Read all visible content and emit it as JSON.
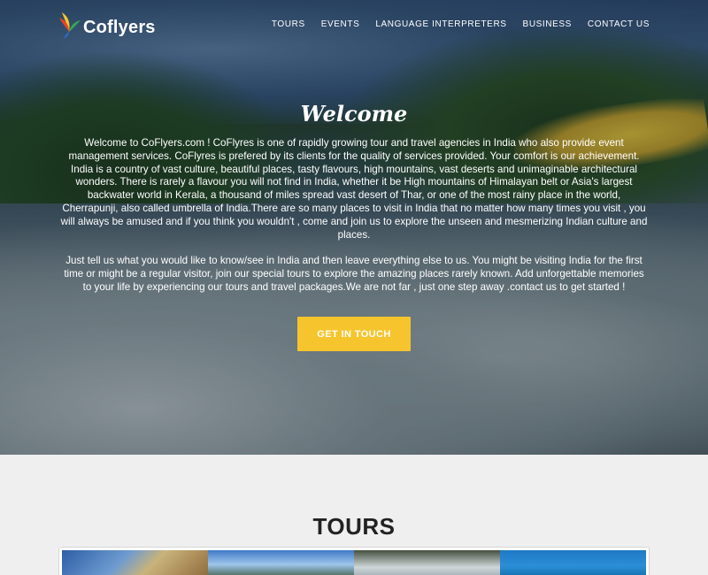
{
  "brand": {
    "name": "Coflyers"
  },
  "nav": {
    "items": [
      {
        "label": "TOURS"
      },
      {
        "label": "EVENTS"
      },
      {
        "label": "LANGUAGE INTERPRETERS"
      },
      {
        "label": "BUSINESS"
      },
      {
        "label": "CONTACT US"
      }
    ]
  },
  "hero": {
    "title": "Welcome",
    "paragraph1": "Welcome to CoFlyers.com ! CoFlyres is one of rapidly growing tour and travel agencies in India who also provide event management services. CoFlyres is prefered by its clients for the quality of services provided. Your comfort is our achievement. India is a country of vast culture, beautiful places, tasty flavours, high mountains, vast deserts and unimaginable architectural wonders. There is rarely a flavour you will not find in India, whether it be High mountains of Himalayan belt or Asia's largest backwater world in Kerala, a thousand of miles spread vast desert of Thar, or one of the most rainy place in the world, Cherrapunji, also called umbrella of India.There are so many places to visit in India that no matter how many times you visit , you will always be amused and if you think you wouldn't , come and join us to explore the unseen and mesmerizing Indian culture and places.",
    "paragraph2": "Just tell us what you would like to know/see in India and then leave everything else to us. You might be visiting India for the first time or might be a regular visitor, join our special tours to explore the amazing places rarely known. Add unforgettable memories to your life by experiencing our tours and travel packages.We are not far , just one step away .contact us to get started !",
    "cta_label": "GET IN TOUCH"
  },
  "tours": {
    "title": "TOURS"
  },
  "colors": {
    "accent": "#f6c52d",
    "section_bg": "#efefef"
  }
}
